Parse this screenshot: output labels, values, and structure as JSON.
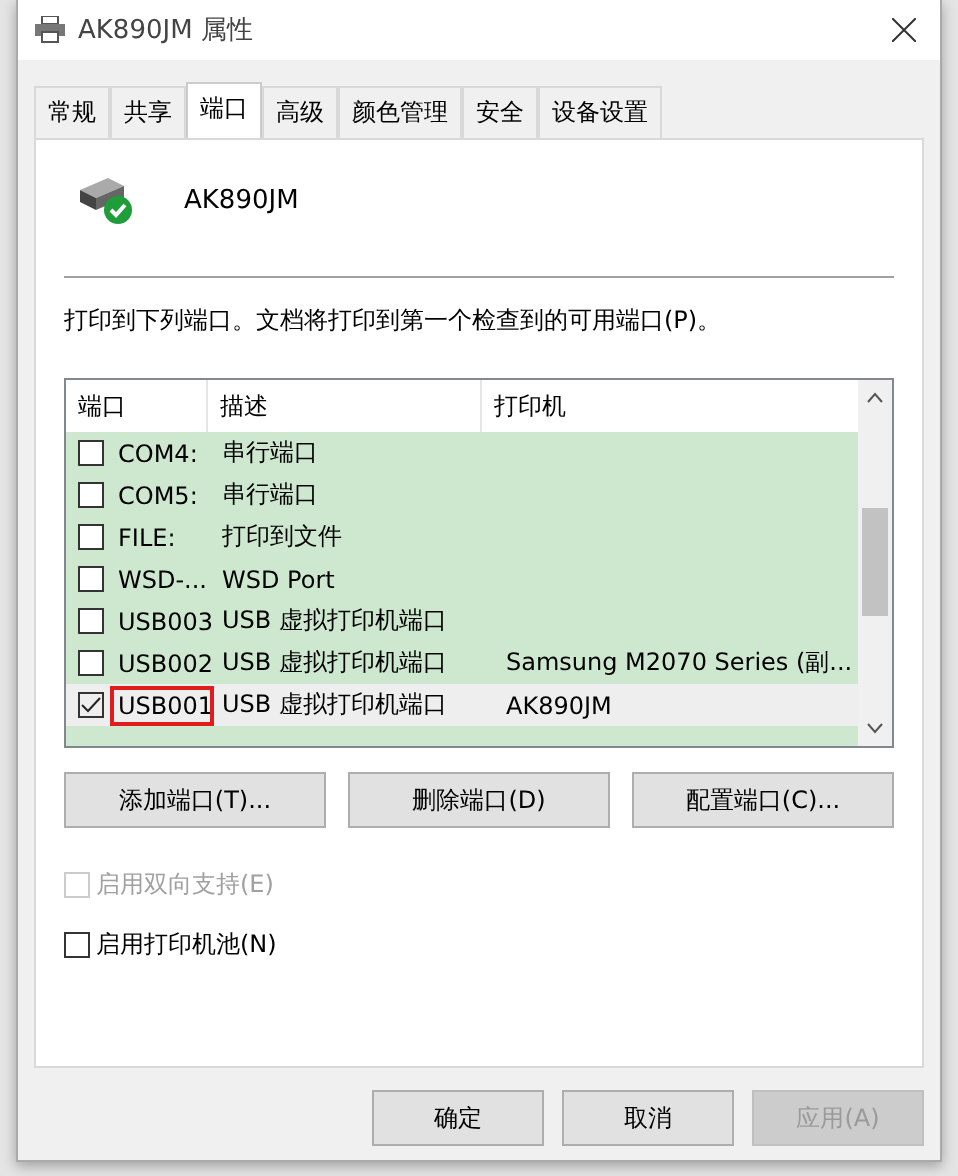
{
  "window": {
    "title": "AK890JM 属性"
  },
  "tabs": [
    {
      "label": "常规",
      "selected": false
    },
    {
      "label": "共享",
      "selected": false
    },
    {
      "label": "端口",
      "selected": true
    },
    {
      "label": "高级",
      "selected": false
    },
    {
      "label": "颜色管理",
      "selected": false
    },
    {
      "label": "安全",
      "selected": false
    },
    {
      "label": "设备设置",
      "selected": false
    }
  ],
  "printer_name": "AK890JM",
  "instruction": "打印到下列端口。文档将打印到第一个检查到的可用端口(P)。",
  "ports": {
    "columns": [
      "端口",
      "描述",
      "打印机"
    ],
    "rows": [
      {
        "port": "COM4:",
        "description": "串行端口",
        "checked": false,
        "selected": false,
        "marked": false
      },
      {
        "port": "COM5:",
        "description": "串行端口",
        "checked": false,
        "selected": false,
        "marked": false
      },
      {
        "port": "FILE:",
        "description": "打印到文件",
        "checked": false,
        "selected": false,
        "marked": false
      },
      {
        "port": "WSD-...",
        "description": "WSD Port",
        "checked": false,
        "selected": false,
        "marked": false
      },
      {
        "port": "USB003",
        "description": "USB 虚拟打印机端口",
        "checked": false,
        "selected": false,
        "marked": false
      },
      {
        "port": "USB002",
        "description": "USB 虚拟打印机端口",
        "printer": "Samsung M2070 Series (副...",
        "checked": false,
        "selected": false,
        "marked": false
      },
      {
        "port": "USB001",
        "description": "USB 虚拟打印机端口",
        "printer": "AK890JM",
        "checked": true,
        "selected": true,
        "marked": true
      }
    ]
  },
  "port_buttons": [
    "添加端口(T)...",
    "删除端口(D)",
    "配置端口(C)..."
  ],
  "options": [
    {
      "label": "启用双向支持(E)",
      "checked": false,
      "disabled": true
    },
    {
      "label": "启用打印机池(N)",
      "checked": false,
      "disabled": false
    }
  ],
  "dialog_buttons": [
    {
      "label": "确定",
      "disabled": false
    },
    {
      "label": "取消",
      "disabled": false
    },
    {
      "label": "应用(A)",
      "disabled": true
    }
  ]
}
